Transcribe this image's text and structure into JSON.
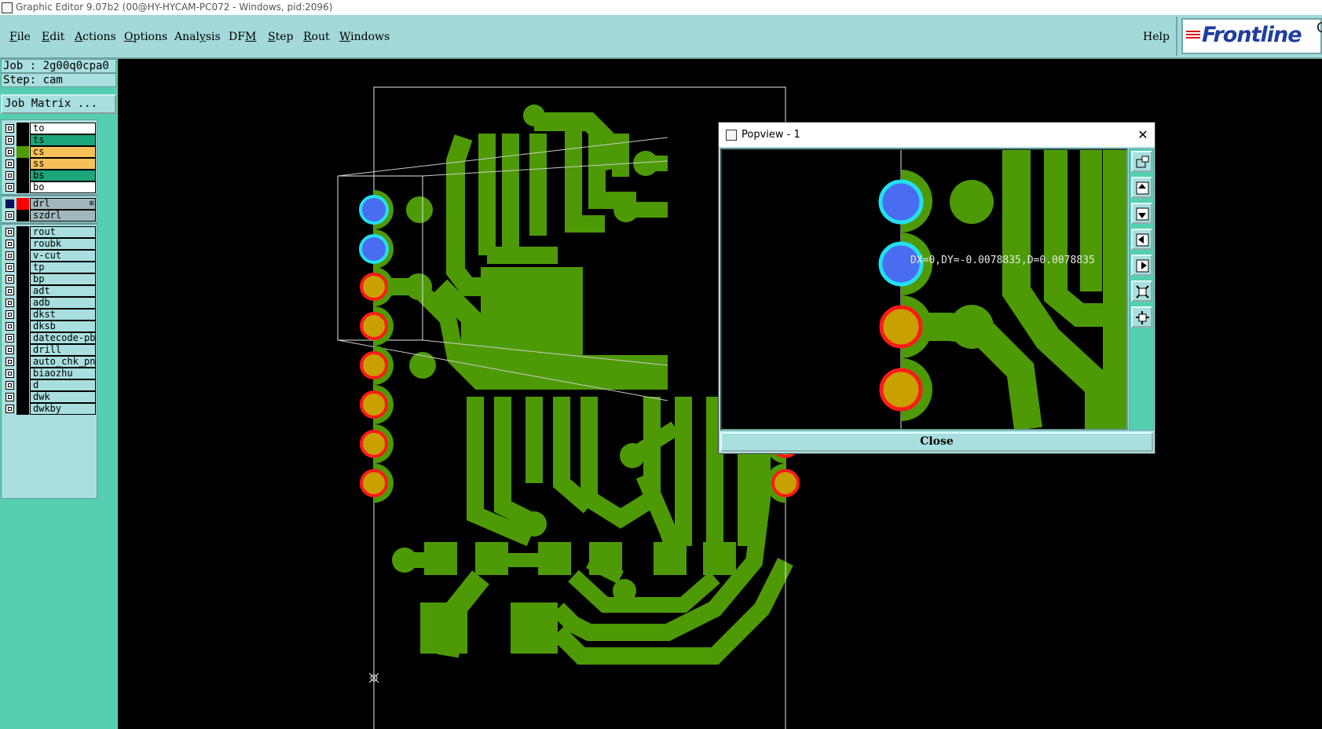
{
  "window": {
    "title": "Graphic Editor 9.07b2 (00@HY-HYCAM-PC072 - Windows, pid:2096)"
  },
  "menu": {
    "items": [
      {
        "label": "File",
        "key": "F"
      },
      {
        "label": "Edit",
        "key": "E"
      },
      {
        "label": "Actions",
        "key": "A"
      },
      {
        "label": "Options",
        "key": "O"
      },
      {
        "label": "Analysis",
        "key": "y"
      },
      {
        "label": "DFM",
        "key": "M"
      },
      {
        "label": "Step",
        "key": "S"
      },
      {
        "label": "Rout",
        "key": "R"
      },
      {
        "label": "Windows",
        "key": "W"
      }
    ],
    "help": "Help"
  },
  "logo": {
    "text": "Frontline",
    "extra": "C"
  },
  "job": {
    "job_label": "Job : 2g00q0cpa0",
    "step_label": "Step: cam",
    "matrix_button": "Job Matrix ..."
  },
  "layers": {
    "groups": [
      [
        {
          "name": "to",
          "bg": "#ffffff",
          "swatch": "#000000"
        },
        {
          "name": "ts",
          "bg": "#1aa57a",
          "swatch": "#000000"
        },
        {
          "name": "cs",
          "bg": "#f7c15a",
          "swatch": "#4e9a06"
        },
        {
          "name": "ss",
          "bg": "#f7c15a",
          "swatch": "#000000"
        },
        {
          "name": "bs",
          "bg": "#1aa57a",
          "swatch": "#000000"
        },
        {
          "name": "bo",
          "bg": "#ffffff",
          "swatch": "#000000"
        }
      ],
      [
        {
          "name": "drl",
          "bg": "#a0b8bc",
          "swatch": "#ff0000",
          "marker": "⊞",
          "active": true
        },
        {
          "name": "szdrl",
          "bg": "#a0b8bc",
          "swatch": "#000000"
        }
      ],
      [
        {
          "name": "rout",
          "bg": "#a9dfdf",
          "swatch": "#000000"
        },
        {
          "name": "roubk",
          "bg": "#a9dfdf",
          "swatch": "#000000"
        },
        {
          "name": "v-cut",
          "bg": "#a9dfdf",
          "swatch": "#000000"
        },
        {
          "name": "tp",
          "bg": "#a9dfdf",
          "swatch": "#000000"
        },
        {
          "name": "bp",
          "bg": "#a9dfdf",
          "swatch": "#000000"
        },
        {
          "name": "adt",
          "bg": "#a9dfdf",
          "swatch": "#000000"
        },
        {
          "name": "adb",
          "bg": "#a9dfdf",
          "swatch": "#000000"
        },
        {
          "name": "dkst",
          "bg": "#a9dfdf",
          "swatch": "#000000"
        },
        {
          "name": "dksb",
          "bg": "#a9dfdf",
          "swatch": "#000000"
        },
        {
          "name": "datecode-pbo",
          "bg": "#a9dfdf",
          "swatch": "#000000"
        },
        {
          "name": "drill",
          "bg": "#a9dfdf",
          "swatch": "#000000"
        },
        {
          "name": "auto_chk_pnl",
          "bg": "#a9dfdf",
          "swatch": "#000000"
        },
        {
          "name": "biaozhu",
          "bg": "#a9dfdf",
          "swatch": "#000000"
        },
        {
          "name": "d",
          "bg": "#a9dfdf",
          "swatch": "#000000"
        },
        {
          "name": "dwk",
          "bg": "#a9dfdf",
          "swatch": "#000000"
        },
        {
          "name": "dwkby",
          "bg": "#a9dfdf",
          "swatch": "#000000"
        }
      ]
    ]
  },
  "colors": {
    "copper": "#4e9a06",
    "pad_fill": "#c8a000",
    "pad_ring": "#ff1a1a",
    "via_fill": "#4a6cf0",
    "via_ring": "#22e0f0",
    "panel_bg": "#55cfb0",
    "widget_bg": "#a9dfdf"
  },
  "popview": {
    "title": "Popview - 1",
    "readout": "DX=0,DY=-0.0078835,D=0.0078835",
    "close_x": "✕",
    "close_button": "Close",
    "tools": [
      "zoom-window-icon",
      "pan-up-icon",
      "pan-down-icon",
      "pan-left-icon",
      "pan-right-icon",
      "zoom-fit-icon",
      "center-icon"
    ]
  }
}
